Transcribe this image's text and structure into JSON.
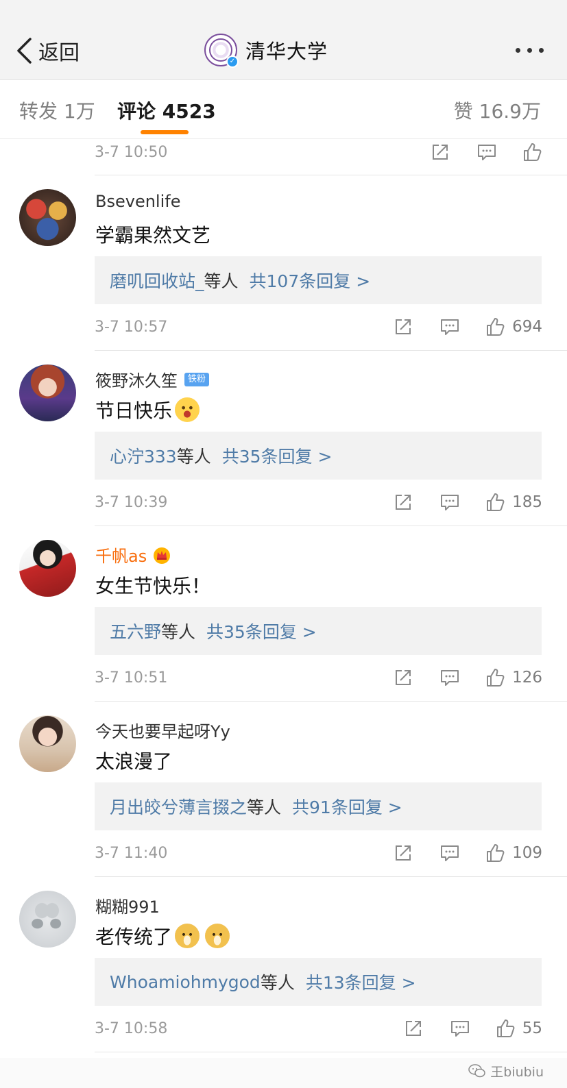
{
  "nav": {
    "back_label": "返回",
    "title": "清华大学",
    "verified_mark": "✓",
    "more_icon": "ellipsis-icon"
  },
  "tabs": {
    "repost": "转发 1万",
    "comments": "评论 4523",
    "likes": "赞 16.9万",
    "active": "comments",
    "accent_color": "#ff8200"
  },
  "colors": {
    "link_blue": "#4f7ba7",
    "vip_orange": "#f86d0c",
    "fan_badge_blue": "#58a3f0"
  },
  "partial_top": {
    "time": "3-7 10:50"
  },
  "comments": [
    {
      "username": "Bsevenlife",
      "content": "学霸果然文艺",
      "reply_users": "磨叽回收站_",
      "reply_etc": "等人",
      "reply_total": "共107条回复 >",
      "time": "3-7 10:57",
      "likes": "694"
    },
    {
      "username": "筱野沐久笙",
      "badge": "铁粉",
      "content": "节日快乐",
      "emoji": "laughing-tears-emoji",
      "reply_users": "心泞333",
      "reply_etc": "等人",
      "reply_total": "共35条回复 >",
      "time": "3-7 10:39",
      "likes": "185"
    },
    {
      "username": "千帆as",
      "badge_icon": "crown-icon",
      "content": "女生节快乐！",
      "reply_users": "五六野",
      "reply_etc": "等人",
      "reply_total": "共35条回复 >",
      "time": "3-7 10:51",
      "likes": "126"
    },
    {
      "username": "今天也要早起呀Yy",
      "content": "太浪漫了",
      "reply_users": "月出皎兮薄言掇之",
      "reply_etc": "等人",
      "reply_total": "共91条回复 >",
      "time": "3-7 11:40",
      "likes": "109"
    },
    {
      "username": "糊糊991",
      "content": "老传统了",
      "emoji": "doge-emoji",
      "reply_users": "Whoamiohmygod",
      "reply_etc": "等人",
      "reply_total": "共13条回复 >",
      "time": "3-7 10:58",
      "likes": "55"
    }
  ],
  "watermark": "王biubiu"
}
